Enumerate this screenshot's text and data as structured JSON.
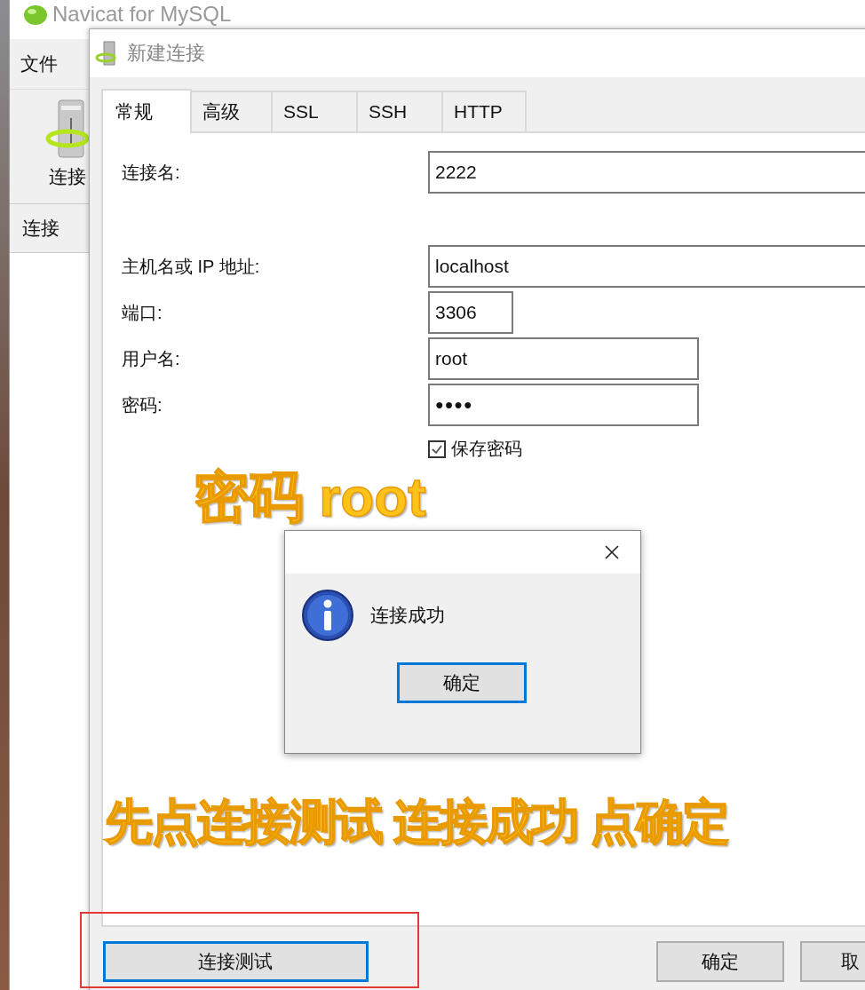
{
  "main_window": {
    "title": "Navicat for MySQL",
    "menu": [
      {
        "label": "文件"
      }
    ],
    "toolbar": [
      {
        "label": "连接"
      }
    ],
    "tabs": [
      {
        "label": "连接",
        "selected": true
      }
    ]
  },
  "dialog": {
    "title": "新建连接",
    "tabs": [
      {
        "label": "常规",
        "selected": true
      },
      {
        "label": "高级",
        "selected": false
      },
      {
        "label": "SSL",
        "selected": false
      },
      {
        "label": "SSH",
        "selected": false
      },
      {
        "label": "HTTP",
        "selected": false
      }
    ],
    "fields": [
      {
        "label": "连接名:",
        "value": "2222",
        "kind": "text"
      },
      {
        "label": "主机名或 IP 地址:",
        "value": "localhost",
        "kind": "text"
      },
      {
        "label": "端口:",
        "value": "3306",
        "kind": "text"
      },
      {
        "label": "用户名:",
        "value": "root",
        "kind": "text"
      },
      {
        "label": "密码:",
        "value": "●●●●",
        "kind": "password"
      }
    ],
    "save_password": {
      "label": "保存密码",
      "checked": true
    },
    "buttons": [
      {
        "label": "连接测试",
        "focused": true
      },
      {
        "label": "确定",
        "focused": false
      },
      {
        "label": "取",
        "focused": false
      }
    ]
  },
  "message_box": {
    "message": "连接成功",
    "button": {
      "label": "确定",
      "focused": true
    }
  },
  "annotations": [
    {
      "text": "密码 root"
    },
    {
      "text": "先点连接测试 连接成功 点确定"
    }
  ]
}
